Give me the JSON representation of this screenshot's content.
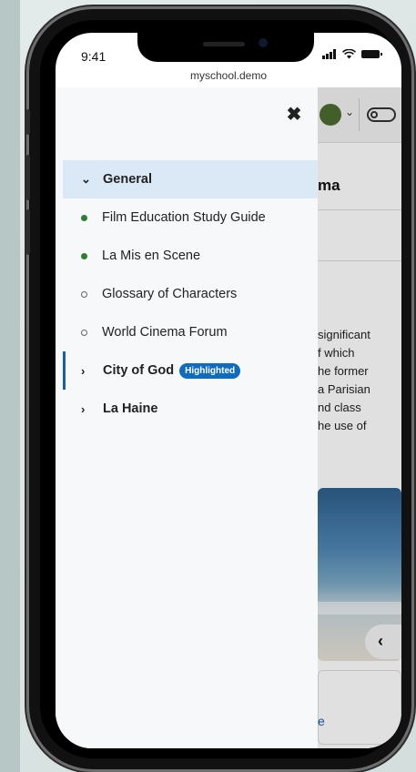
{
  "status": {
    "time": "9:41"
  },
  "browser": {
    "url": "myschool.demo"
  },
  "page": {
    "heading_fragment": "ma",
    "body_fragments": [
      "significant",
      "f which",
      "he former",
      "a Parisian",
      "nd class",
      "he use of"
    ],
    "card_fragment": "e"
  },
  "drawer": {
    "close_label": "✖",
    "section": {
      "label": "General",
      "expanded": true
    },
    "items": [
      {
        "label": "Film Education Study Guide",
        "status": "completed"
      },
      {
        "label": "La Mis en Scene",
        "status": "completed"
      },
      {
        "label": "Glossary of Characters",
        "status": "not-started"
      },
      {
        "label": "World Cinema Forum",
        "status": "not-started"
      }
    ],
    "sections": [
      {
        "label": "City of God",
        "badge": "Highlighted",
        "active": true
      },
      {
        "label": "La Haine",
        "badge": "",
        "active": false
      }
    ]
  },
  "colors": {
    "accent": "#1a5dab",
    "badge": "#0f6cbd",
    "completed": "#2e7d32",
    "general_bg": "#dbe9f6"
  }
}
